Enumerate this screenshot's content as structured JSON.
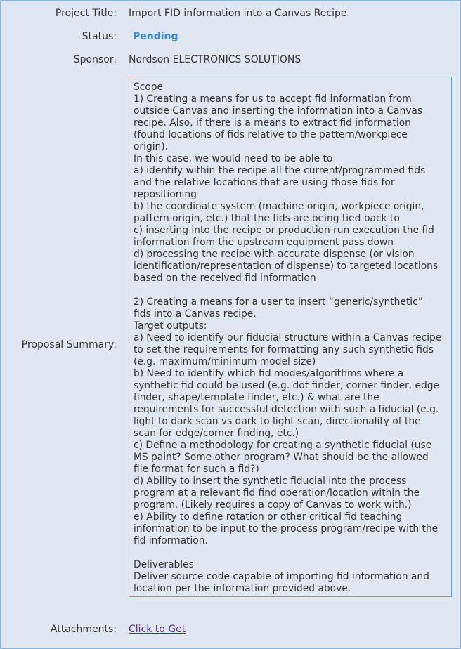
{
  "labels": {
    "project_title": "Project Title:",
    "status": "Status:",
    "sponsor": "Sponsor:",
    "proposal_summary": "Proposal Summary:",
    "attachments": "Attachments:"
  },
  "values": {
    "project_title": "Import FID information into a Canvas Recipe",
    "status": "Pending",
    "sponsor": "Nordson ELECTRONICS SOLUTIONS",
    "attachments_link": "Click to Get"
  },
  "proposal_summary": "Scope\n1) Creating a means for us to accept fid information from\noutside Canvas and inserting the information into a Canvas\nrecipe. Also, if there is a means to extract fid information\n(found locations of fids relative to the pattern/workpiece\norigin).\nIn this case, we would need to be able to\na) identify within the recipe all the current/programmed fids\nand the relative locations that are using those fids for\nrepositioning\nb) the coordinate system (machine origin, workpiece origin,\npattern origin, etc.) that the fids are being tied back to\nc) inserting into the recipe or production run execution the fid\ninformation from the upstream equipment pass down\nd) processing the recipe with accurate dispense (or vision\nidentification/representation of dispense) to targeted locations\nbased on the received fid information\n\n2) Creating a means for a user to insert “generic/synthetic”\nfids into a Canvas recipe.\nTarget outputs:\na) Need to identify our fiducial structure within a Canvas recipe\nto set the requirements for formatting any such synthetic fids\n(e.g. maximum/minimum model size)\nb) Need to identify which fid modes/algorithms where a\nsynthetic fid could be used (e.g. dot finder, corner finder, edge\nfinder, shape/template finder, etc.) & what are the\nrequirements for successful detection with such a fiducial (e.g.\nlight to dark scan vs dark to light scan, directionality of the\nscan for edge/corner finding, etc.)\nc) Define a methodology for creating a synthetic fiducial (use\nMS paint? Some other program? What should be the allowed\nfile format for such a fid?)\nd) Ability to insert the synthetic fiducial into the process\nprogram at a relevant fid find operation/location within the\nprogram. (Likely requires a copy of Canvas to work with.)\ne) Ability to define rotation or other critical fid teaching\ninformation to be input to the process program/recipe with the\nfid information.\n\nDeliverables\nDeliver source code capable of importing fid information and\nlocation per the information provided above.",
  "colors": {
    "panel_background": "#dfe8f2",
    "panel_border": "#8fb1d2",
    "status": "#3a86d8",
    "summary_border": "#5aa6e0",
    "link": "#5b2d90"
  }
}
